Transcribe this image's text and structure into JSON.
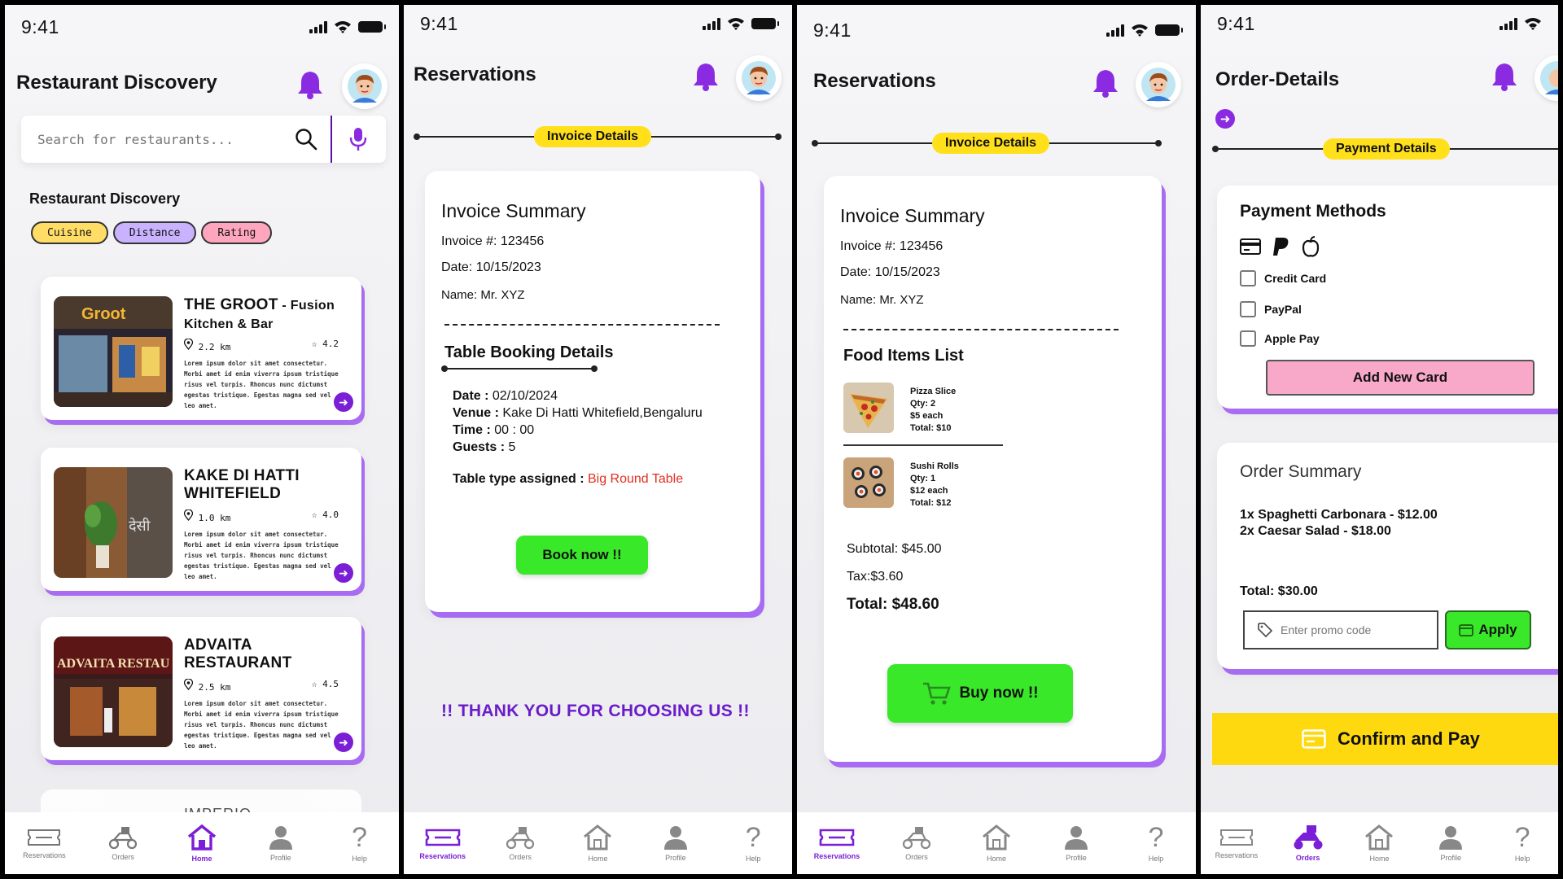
{
  "status": {
    "time": "9:41"
  },
  "screen1": {
    "title": "Restaurant Discovery",
    "search_placeholder": "Search for restaurants...",
    "section_title": "Restaurant Discovery",
    "filters": [
      {
        "label": "Cuisine",
        "color": "#ffdd66"
      },
      {
        "label": "Distance",
        "color": "#c9b3ff"
      },
      {
        "label": "Rating",
        "color": "#ffa6bf"
      }
    ],
    "restaurants": [
      {
        "name": "THE GROOT",
        "name_suffix": " - Fusion Kitchen & Bar",
        "distance": "2.2 km",
        "rating": "4.2",
        "desc": "Lorem ipsum dolor sit amet consectetur. Morbi amet id enim viverra ipsum tristique risus vel turpis. Rhoncus nunc dictumst egestas tristique. Egestas magna sed vel leo amet."
      },
      {
        "name": "KAKE DI HATTI WHITEFIELD",
        "name_suffix": "",
        "distance": "1.0 km",
        "rating": "4.0",
        "desc": "Lorem ipsum dolor sit amet consectetur. Morbi amet id enim viverra ipsum tristique risus vel turpis. Rhoncus nunc dictumst egestas tristique. Egestas magna sed vel leo amet."
      },
      {
        "name": "ADVAITA RESTAURANT",
        "name_suffix": "",
        "distance": "2.5 km",
        "rating": "4.5",
        "desc": "Lorem ipsum dolor sit amet consectetur. Morbi amet id enim viverra ipsum tristique risus vel turpis. Rhoncus nunc dictumst egestas tristique. Egestas magna sed vel leo amet."
      }
    ],
    "partial_card_name": "IMPERIO",
    "nav": [
      {
        "label": "Reservations",
        "icon": "ticket-icon"
      },
      {
        "label": "Orders",
        "icon": "delivery-scooter-icon"
      },
      {
        "label": "Home",
        "icon": "home-icon"
      },
      {
        "label": "Profile",
        "icon": "profile-icon"
      },
      {
        "label": "Help",
        "icon": "help-icon"
      }
    ]
  },
  "screen2": {
    "title": "Reservations",
    "step_label": "Invoice Details",
    "card_title": "Invoice Summary",
    "invoice_no": "Invoice #: 123456",
    "date": "Date: 10/15/2023",
    "name": "Name: Mr. XYZ",
    "booking_title": "Table Booking Details",
    "booking": {
      "date_label": "Date :",
      "date_value": " 02/10/2024",
      "venue_label": "Venue :",
      "venue_value": " Kake Di Hatti  Whitefield,Bengaluru",
      "time_label": "Time :",
      "time_value": " 00 : 00",
      "guests_label": "Guests :",
      "guests_value": " 5",
      "table_label": "Table type assigned : ",
      "table_value": "Big Round Table"
    },
    "book_button": "Book now !!",
    "thanks": "!!  THANK YOU FOR CHOOSING US !!"
  },
  "screen3": {
    "title": "Reservations",
    "step_label": "Invoice Details",
    "card_title": "Invoice Summary",
    "invoice_no": "Invoice #: 123456",
    "date": "Date: 10/15/2023",
    "name": "Name: Mr. XYZ",
    "food_title": "Food Items List",
    "items": [
      {
        "name": "Pizza Slice",
        "qty": "Qty: 2",
        "each": "$5 each",
        "total": "Total: $10"
      },
      {
        "name": "Sushi Rolls",
        "qty": "Qty: 1",
        "each": "$12 each",
        "total": "Total: $12"
      }
    ],
    "subtotal": "Subtotal: $45.00",
    "tax": "Tax:$3.60",
    "total": "Total: $48.60",
    "buy_button": "Buy now !!"
  },
  "screen4": {
    "title": "Order-Details",
    "step_label": "Payment Details",
    "pm_title": "Payment Methods",
    "methods": [
      "Credit Card",
      "PayPal",
      "Apple Pay"
    ],
    "add_card": "Add New Card",
    "summary_title": "Order Summary",
    "lines": [
      "1x Spaghetti Carbonara - $12.00",
      "2x Caesar Salad - $18.00"
    ],
    "total": "Total: $30.00",
    "promo_placeholder": "Enter promo code",
    "apply": "Apply",
    "confirm": "Confirm and Pay"
  },
  "colors": {
    "accent": "#7a1fd6",
    "yellow": "#ffe01b",
    "green": "#39e829",
    "red_text": "#e03020"
  }
}
